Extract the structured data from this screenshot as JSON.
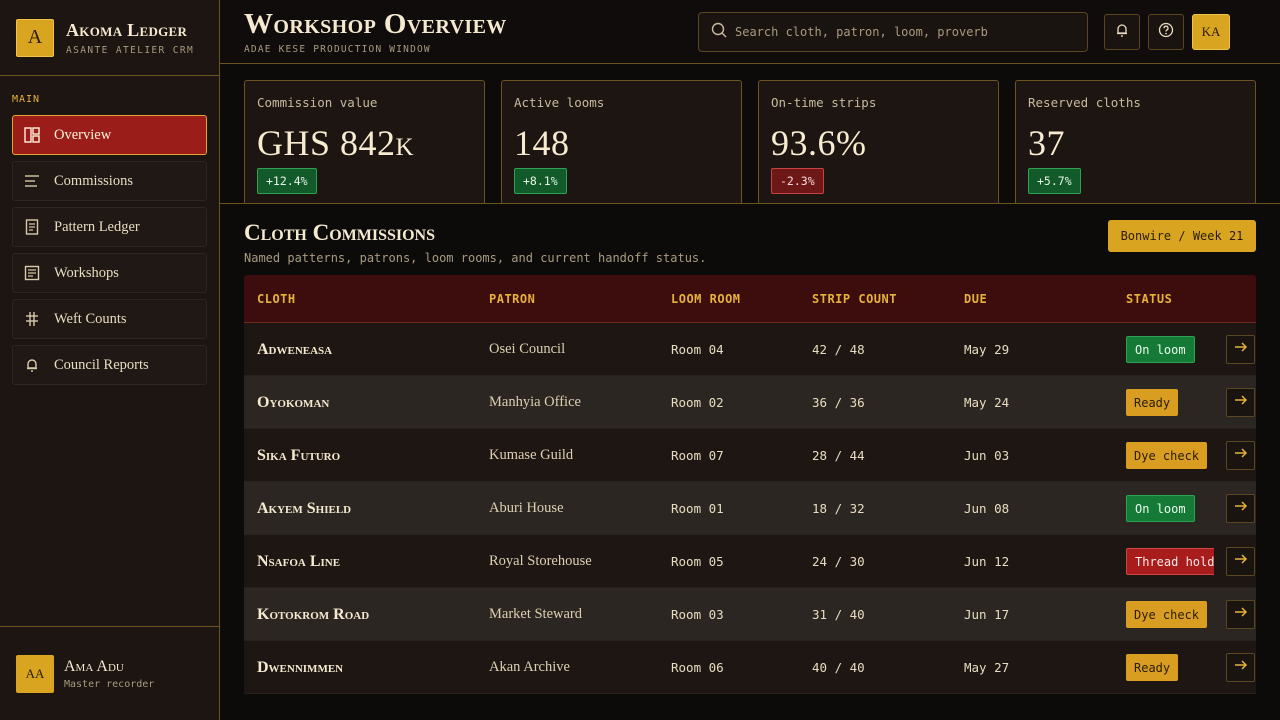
{
  "app": {
    "logo_letter": "A",
    "title": "Akoma Ledger",
    "subtitle": "ASANTE ATELIER CRM"
  },
  "nav": {
    "section": "MAIN",
    "items": [
      {
        "label": "Overview",
        "icon": "dashboard-icon",
        "active": true
      },
      {
        "label": "Commissions",
        "icon": "list-icon"
      },
      {
        "label": "Pattern Ledger",
        "icon": "document-icon"
      },
      {
        "label": "Workshops",
        "icon": "board-icon"
      },
      {
        "label": "Weft Counts",
        "icon": "weft-icon"
      },
      {
        "label": "Council Reports",
        "icon": "bell-outline-icon"
      }
    ]
  },
  "user": {
    "initials": "AA",
    "name": "Ama Adu",
    "role": "Master recorder"
  },
  "header": {
    "title": "Workshop Overview",
    "subtitle": "ADAE KESE PRODUCTION WINDOW",
    "search_placeholder": "Search cloth, patron, loom, proverb",
    "account_initials": "KA"
  },
  "kpis": [
    {
      "label": "Commission value",
      "value": "GHS 842k",
      "delta": "+12.4%",
      "trend": "up"
    },
    {
      "label": "Active looms",
      "value": "148",
      "delta": "+8.1%",
      "trend": "up"
    },
    {
      "label": "On-time strips",
      "value": "93.6%",
      "delta": "-2.3%",
      "trend": "down"
    },
    {
      "label": "Reserved cloths",
      "value": "37",
      "delta": "+5.7%",
      "trend": "up"
    }
  ],
  "commissions": {
    "title": "Cloth Commissions",
    "subtitle": "Named patterns, patrons, loom rooms, and current handoff status.",
    "week_button": "Bonwire / Week 21",
    "columns": [
      "CLOTH",
      "PATRON",
      "LOOM ROOM",
      "STRIP COUNT",
      "DUE",
      "STATUS"
    ],
    "rows": [
      {
        "cloth": "Adweneasa",
        "patron": "Osei Council",
        "room": "Room 04",
        "strips": "42 / 48",
        "due": "May 29",
        "status": "On loom",
        "tone": "green"
      },
      {
        "cloth": "Oyokoman",
        "patron": "Manhyia Office",
        "room": "Room 02",
        "strips": "36 / 36",
        "due": "May 24",
        "status": "Ready",
        "tone": "gold"
      },
      {
        "cloth": "Sika Futuro",
        "patron": "Kumase Guild",
        "room": "Room 07",
        "strips": "28 / 44",
        "due": "Jun 03",
        "status": "Dye check",
        "tone": "gold"
      },
      {
        "cloth": "Akyem Shield",
        "patron": "Aburi House",
        "room": "Room 01",
        "strips": "18 / 32",
        "due": "Jun 08",
        "status": "On loom",
        "tone": "green"
      },
      {
        "cloth": "Nsafoa Line",
        "patron": "Royal Storehouse",
        "room": "Room 05",
        "strips": "24 / 30",
        "due": "Jun 12",
        "status": "Thread hold",
        "tone": "red"
      },
      {
        "cloth": "Kotokrom Road",
        "patron": "Market Steward",
        "room": "Room 03",
        "strips": "31 / 40",
        "due": "Jun 17",
        "status": "Dye check",
        "tone": "gold"
      },
      {
        "cloth": "Dwennimmen",
        "patron": "Akan Archive",
        "room": "Room 06",
        "strips": "40 / 40",
        "due": "May 27",
        "status": "Ready",
        "tone": "gold"
      }
    ]
  },
  "colors": {
    "accent_gold": "#d9a521",
    "active_red": "#9b1d1a",
    "status_green": "#157a35",
    "status_red": "#a81c1c"
  }
}
